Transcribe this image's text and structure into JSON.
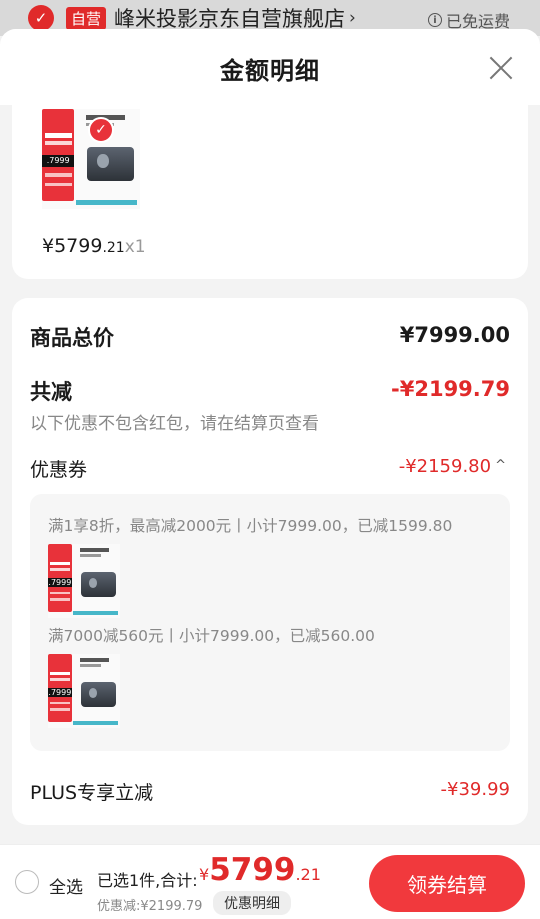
{
  "store": {
    "tag": "自营",
    "name": "峰米投影京东自营旗舰店",
    "arrow": "›",
    "shipping": "已免运费",
    "info_glyph": "i"
  },
  "sheet": {
    "title": "金额明细",
    "product": {
      "thumb_price": ".7999",
      "price_yen": "¥5799",
      "price_cents": ".21",
      "qty": "x1"
    }
  },
  "summary": {
    "goods_total_label": "商品总价",
    "goods_total_value": "¥7999.00",
    "total_discount_label": "共减",
    "total_discount_value": "-¥2199.79",
    "note": "以下优惠不包含红包，请在结算页查看",
    "coupon_label": "优惠券",
    "coupon_value": "-¥2159.80",
    "coupon_toggle": "^",
    "coupons": [
      {
        "desc": "满1享8折，最高减2000元丨小计7999.00，已减1599.80"
      },
      {
        "desc": "满7000减560元丨小计7999.00，已减560.00"
      }
    ],
    "plus_label": "PLUS专享立减",
    "plus_value": "-¥39.99"
  },
  "bottom": {
    "select_all": "全选",
    "selected_info": "已选1件,合计:",
    "total_yen": "¥",
    "total_int": "5799",
    "total_cents": ".21",
    "discount_text": "优惠减:¥2199.79",
    "detail_button": "优惠明细",
    "checkout_button": "领券结算"
  },
  "colors": {
    "accent_red": "#e02a2a",
    "checkout_red": "#f1393d"
  },
  "icons": [
    "check-icon",
    "info-icon",
    "close-icon",
    "chevron-up-icon",
    "radio-icon"
  ]
}
